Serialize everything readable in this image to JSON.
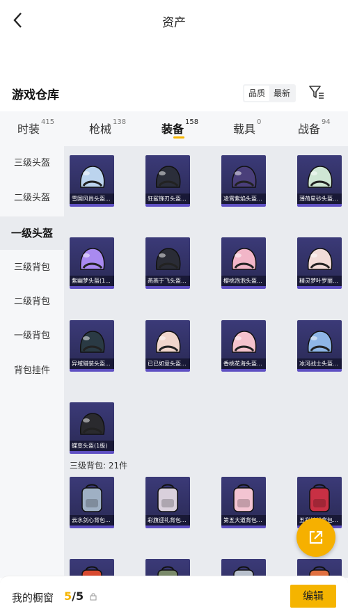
{
  "header": {
    "title": "资产"
  },
  "warehouse": {
    "title": "游戏仓库",
    "sort_quality": "品质",
    "sort_latest": "最新"
  },
  "tabs": [
    {
      "label": "时装",
      "count": "415"
    },
    {
      "label": "枪械",
      "count": "138"
    },
    {
      "label": "装备",
      "count": "158"
    },
    {
      "label": "载具",
      "count": "0"
    },
    {
      "label": "战备",
      "count": "94"
    }
  ],
  "sidebar": {
    "items": [
      {
        "label": "三级头盔"
      },
      {
        "label": "二级头盔"
      },
      {
        "label": "一级头盔"
      },
      {
        "label": "三级背包"
      },
      {
        "label": "二级背包"
      },
      {
        "label": "一级背包"
      },
      {
        "label": "背包挂件"
      }
    ]
  },
  "helmets": [
    {
      "name": "雪国风尚头盔...",
      "color": "#bcd4ee"
    },
    {
      "name": "狂鲨锋刃头盔...",
      "color": "#2b2e3a"
    },
    {
      "name": "凌霄紫焰头盔...",
      "color": "#4a3f7a"
    },
    {
      "name": "薄荷星砂头盔...",
      "color": "#cfe6d4"
    },
    {
      "name": "紫幽梦头盔(1...",
      "color": "#a98af0"
    },
    {
      "name": "燕燕于飞头盔...",
      "color": "#2a2c36"
    },
    {
      "name": "樱桃泡泡头盔...",
      "color": "#f2b6c8"
    },
    {
      "name": "精灵梦叶罗丽...",
      "color": "#f2dcd8"
    },
    {
      "name": "异域猎装头盔...",
      "color": "#2a3a44"
    },
    {
      "name": "已已如意头盔...",
      "color": "#f0d6cc"
    },
    {
      "name": "香桃花海头盔...",
      "color": "#f4c2cc"
    },
    {
      "name": "冰河战士头盔...",
      "color": "#8fb6e6"
    },
    {
      "name": "蝶变头盔(1级)",
      "color": "#2a2a2e"
    }
  ],
  "backpack_section": {
    "label": "三级背包: 21件"
  },
  "backpacks": [
    {
      "name": "云水剑心背包...",
      "color": "#9fb0c4"
    },
    {
      "name": "彩旗迎礼背包...",
      "color": "#d9d0dc"
    },
    {
      "name": "第五大道背包...",
      "color": "#f3c4d2"
    },
    {
      "name": "五彩缤纷背包...",
      "color": "#c83044"
    }
  ],
  "backpacks_row2_colors": [
    "#d84a30",
    "#7a8a6a",
    "#b8c0cc",
    "#e07040"
  ],
  "footer": {
    "label": "我的橱窗",
    "current": "5",
    "total": "/5",
    "edit_label": "编辑"
  },
  "colors": {
    "accent": "#f5b400",
    "card_bg": "#3b3a78",
    "card_border": "#5e4fc2"
  }
}
